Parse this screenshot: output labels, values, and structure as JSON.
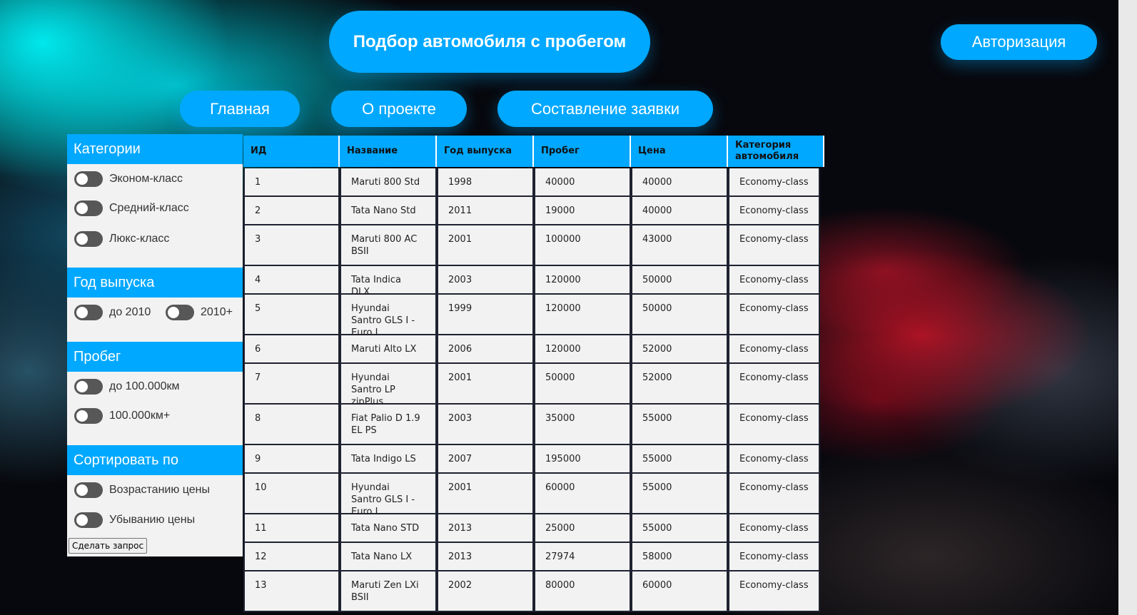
{
  "header": {
    "title": "Подбор автомобиля с пробегом",
    "auth_label": "Авторизация"
  },
  "nav": {
    "items": [
      {
        "label": "Главная"
      },
      {
        "label": "О проекте"
      },
      {
        "label": "Составление заявки"
      }
    ]
  },
  "sidebar": {
    "sections": [
      {
        "title": "Категории",
        "options": [
          "Эконом-класс",
          "Средний-класс",
          "Люкс-класс"
        ]
      },
      {
        "title": "Год выпуска",
        "options": [
          "до 2010",
          "2010+"
        ]
      },
      {
        "title": "Пробег",
        "options": [
          "до 100.000км",
          "100.000км+"
        ]
      },
      {
        "title": "Сортировать по",
        "options": [
          "Возрастанию цены",
          "Убыванию цены"
        ]
      }
    ],
    "submit_label": "Сделать запрос"
  },
  "table": {
    "columns": [
      "ИД",
      "Название",
      "Год выпуска",
      "Пробег",
      "Цена",
      "Категория автомобиля"
    ],
    "rows": [
      [
        "1",
        "Maruti 800 Std",
        "1998",
        "40000",
        "40000",
        "Economy-class"
      ],
      [
        "2",
        "Tata Nano Std",
        "2011",
        "19000",
        "40000",
        "Economy-class"
      ],
      [
        "3",
        "Maruti 800 AC BSII",
        "2001",
        "100000",
        "43000",
        "Economy-class"
      ],
      [
        "4",
        "Tata Indica DLX",
        "2003",
        "120000",
        "50000",
        "Economy-class"
      ],
      [
        "5",
        "Hyundai Santro GLS I - Euro I",
        "1999",
        "120000",
        "50000",
        "Economy-class"
      ],
      [
        "6",
        "Maruti Alto LX",
        "2006",
        "120000",
        "52000",
        "Economy-class"
      ],
      [
        "7",
        "Hyundai Santro LP zipPlus",
        "2001",
        "50000",
        "52000",
        "Economy-class"
      ],
      [
        "8",
        "Fiat Palio D 1.9 EL PS",
        "2003",
        "35000",
        "55000",
        "Economy-class"
      ],
      [
        "9",
        "Tata Indigo LS",
        "2007",
        "195000",
        "55000",
        "Economy-class"
      ],
      [
        "10",
        "Hyundai Santro GLS I - Euro I",
        "2001",
        "60000",
        "55000",
        "Economy-class"
      ],
      [
        "11",
        "Tata Nano STD",
        "2013",
        "25000",
        "55000",
        "Economy-class"
      ],
      [
        "12",
        "Tata Nano LX",
        "2013",
        "27974",
        "58000",
        "Economy-class"
      ],
      [
        "13",
        "Maruti Zen LXi BSII",
        "2002",
        "80000",
        "60000",
        "Economy-class"
      ]
    ]
  }
}
